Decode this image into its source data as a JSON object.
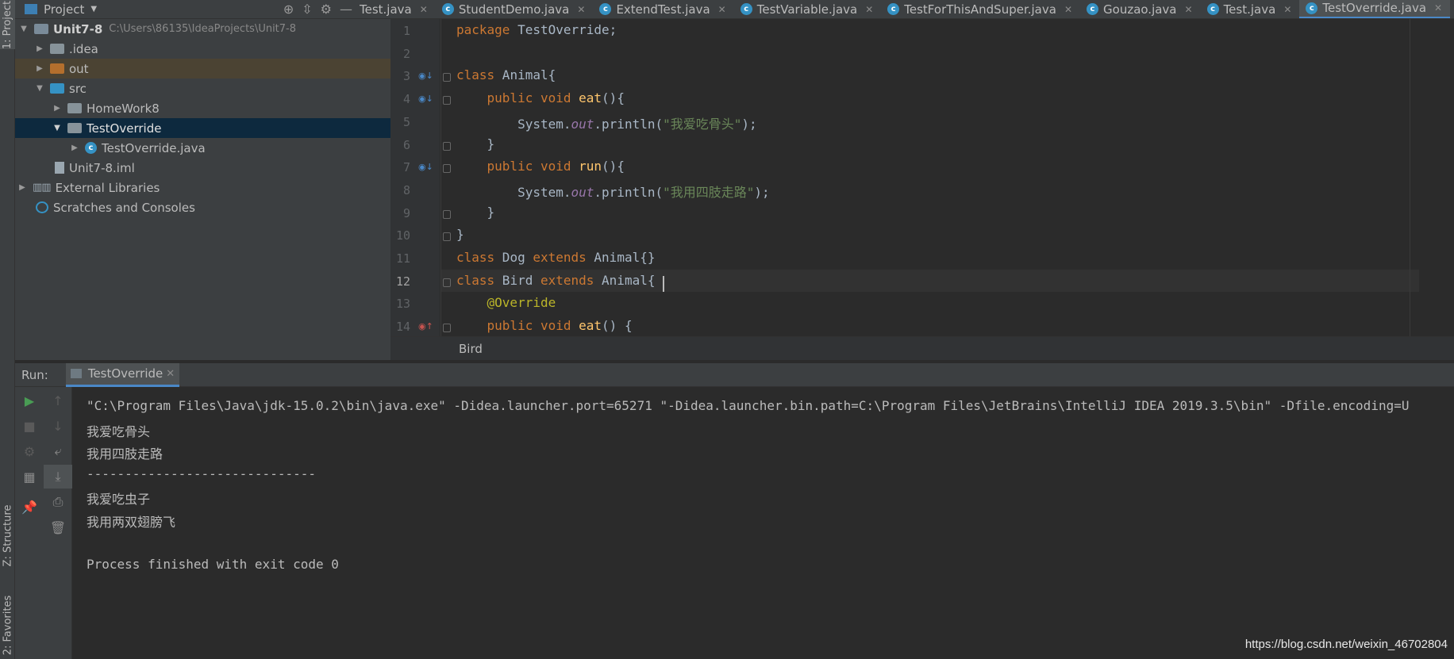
{
  "sidebar_tabs": {
    "project": "1: Project",
    "structure": "Z: Structure",
    "favorites": "2: Favorites"
  },
  "project_panel": {
    "title": "Project"
  },
  "tabs": [
    {
      "label": "Test.java",
      "icon": "class-icon",
      "active": false
    },
    {
      "label": "StudentDemo.java",
      "icon": "class-icon",
      "active": false
    },
    {
      "label": "ExtendTest.java",
      "icon": "class-icon",
      "active": false
    },
    {
      "label": "TestVariable.java",
      "icon": "class-icon",
      "active": false
    },
    {
      "label": "TestForThisAndSuper.java",
      "icon": "class-icon",
      "active": false
    },
    {
      "label": "Gouzao.java",
      "icon": "class-icon",
      "active": false
    },
    {
      "label": "Test.java",
      "icon": "class-icon",
      "active": false
    },
    {
      "label": "TestOverride.java",
      "icon": "class-icon",
      "active": true
    }
  ],
  "tree": {
    "root_name": "Unit7-8",
    "root_path": "C:\\Users\\86135\\IdeaProjects\\Unit7-8",
    "items": [
      {
        "label": ".idea"
      },
      {
        "label": "out"
      },
      {
        "label": "src"
      },
      {
        "label": "HomeWork8"
      },
      {
        "label": "TestOverride"
      },
      {
        "label": "TestOverride.java"
      },
      {
        "label": "Unit7-8.iml"
      },
      {
        "label": "External Libraries"
      },
      {
        "label": "Scratches and Consoles"
      }
    ]
  },
  "editor": {
    "line_numbers": [
      "1",
      "2",
      "3",
      "4",
      "5",
      "6",
      "7",
      "8",
      "9",
      "10",
      "11",
      "12",
      "13",
      "14"
    ],
    "current_line": "12",
    "lines": [
      {
        "t1": "package",
        "t2": " TestOverride;"
      },
      {},
      {
        "t1": "class",
        "t2": " Animal{"
      },
      {
        "t0": "    ",
        "t1": "public void",
        "t2": " ",
        "t3": "eat",
        "t4": "(){"
      },
      {
        "t0": "        System.",
        "t1": "out",
        "t2": ".println(",
        "t3": "\"我爱吃骨头\"",
        "t4": ");"
      },
      {
        "t0": "    }"
      },
      {
        "t0": "    ",
        "t1": "public void",
        "t2": " ",
        "t3": "run",
        "t4": "(){"
      },
      {
        "t0": "        System.",
        "t1": "out",
        "t2": ".println(",
        "t3": "\"我用四肢走路\"",
        "t4": ");"
      },
      {
        "t0": "    }"
      },
      {
        "t0": "}"
      },
      {
        "t1": "class",
        "t2": " Dog ",
        "t3": "extends",
        "t4": " Animal{}"
      },
      {
        "t1": "class",
        "t2": " Bird ",
        "t3": "extends",
        "t4": " Animal{"
      },
      {
        "t0": "    ",
        "t1": "@Override"
      },
      {
        "t0": "    ",
        "t1": "public void",
        "t2": " ",
        "t3": "eat",
        "t4": "() {"
      }
    ],
    "breadcrumb": "Bird"
  },
  "run": {
    "label": "Run:",
    "tab_label": "TestOverride",
    "console_lines": [
      "\"C:\\Program Files\\Java\\jdk-15.0.2\\bin\\java.exe\" -Didea.launcher.port=65271 \"-Didea.launcher.bin.path=C:\\Program Files\\JetBrains\\IntelliJ IDEA 2019.3.5\\bin\" -Dfile.encoding=U",
      "我爱吃骨头",
      "我用四肢走路",
      "------------------------------",
      "我爱吃虫子",
      "我用两双翅膀飞",
      "",
      "Process finished with exit code 0"
    ]
  },
  "watermark": "https://blog.csdn.net/weixin_46702804",
  "colors": {
    "accent": "#4a88c7",
    "keyword": "#cc7832",
    "method": "#ffc66d",
    "string": "#6a8759",
    "field": "#9876aa",
    "annotation": "#bbb529",
    "run_green": "#499c54"
  }
}
